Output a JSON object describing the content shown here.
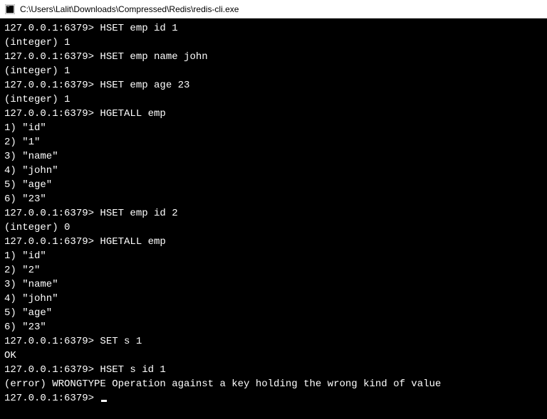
{
  "window": {
    "title": "C:\\Users\\Lalit\\Downloads\\Compressed\\Redis\\redis-cli.exe"
  },
  "prompt": "127.0.0.1:6379>",
  "lines": [
    {
      "type": "cmd",
      "text": "HSET emp id 1"
    },
    {
      "type": "out",
      "text": "(integer) 1"
    },
    {
      "type": "cmd",
      "text": "HSET emp name john"
    },
    {
      "type": "out",
      "text": "(integer) 1"
    },
    {
      "type": "cmd",
      "text": "HSET emp age 23"
    },
    {
      "type": "out",
      "text": "(integer) 1"
    },
    {
      "type": "cmd",
      "text": "HGETALL emp"
    },
    {
      "type": "out",
      "text": "1) \"id\""
    },
    {
      "type": "out",
      "text": "2) \"1\""
    },
    {
      "type": "out",
      "text": "3) \"name\""
    },
    {
      "type": "out",
      "text": "4) \"john\""
    },
    {
      "type": "out",
      "text": "5) \"age\""
    },
    {
      "type": "out",
      "text": "6) \"23\""
    },
    {
      "type": "cmd",
      "text": "HSET emp id 2"
    },
    {
      "type": "out",
      "text": "(integer) 0"
    },
    {
      "type": "cmd",
      "text": "HGETALL emp"
    },
    {
      "type": "out",
      "text": "1) \"id\""
    },
    {
      "type": "out",
      "text": "2) \"2\""
    },
    {
      "type": "out",
      "text": "3) \"name\""
    },
    {
      "type": "out",
      "text": "4) \"john\""
    },
    {
      "type": "out",
      "text": "5) \"age\""
    },
    {
      "type": "out",
      "text": "6) \"23\""
    },
    {
      "type": "cmd",
      "text": "SET s 1"
    },
    {
      "type": "out",
      "text": "OK"
    },
    {
      "type": "cmd",
      "text": "HSET s id 1"
    },
    {
      "type": "out",
      "text": "(error) WRONGTYPE Operation against a key holding the wrong kind of value"
    },
    {
      "type": "cmd",
      "text": ""
    }
  ]
}
